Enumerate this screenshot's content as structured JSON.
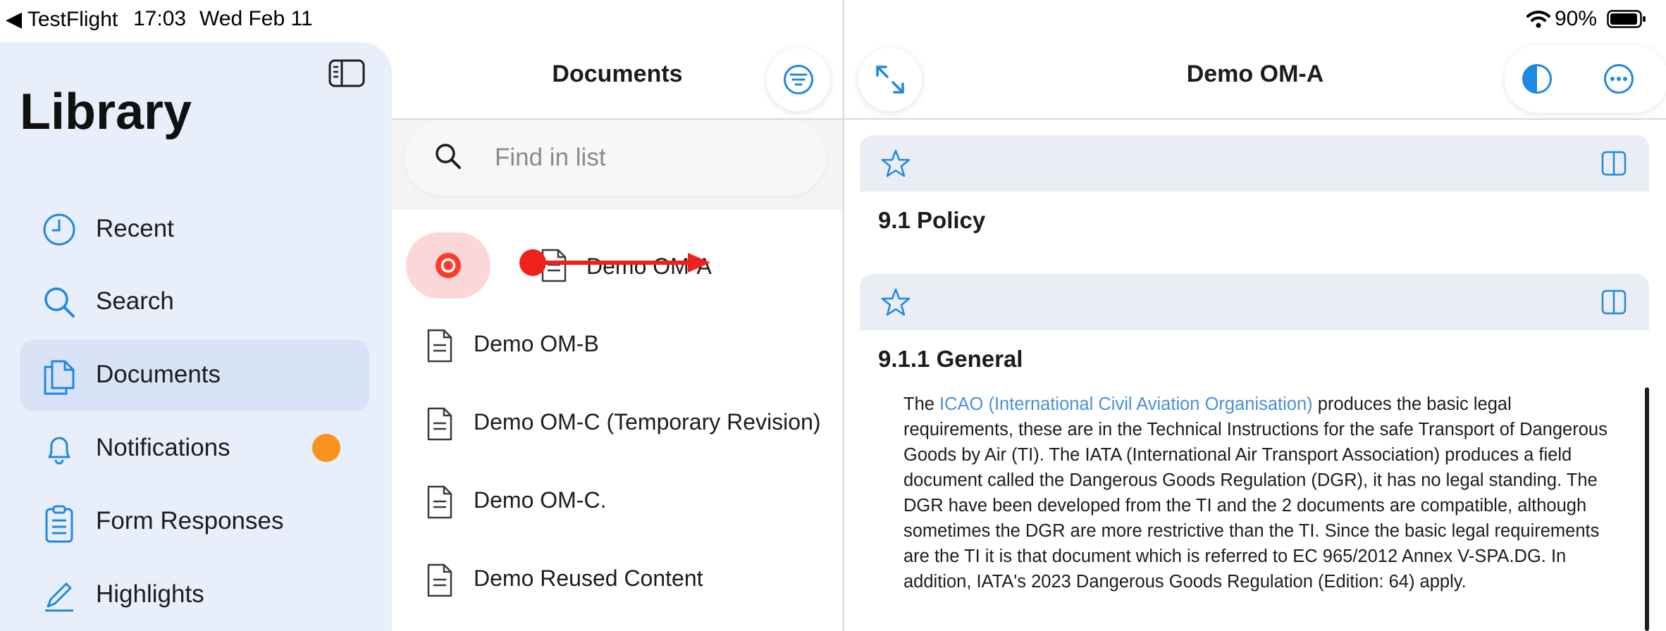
{
  "status_bar": {
    "back_app": "◀ TestFlight",
    "time": "17:03",
    "date": "Wed Feb 11",
    "battery_percent": "90%",
    "icons": [
      "wifi-icon",
      "battery-icon"
    ]
  },
  "sidebar": {
    "title": "Library",
    "items": [
      {
        "label": "Recent",
        "icon": "clock-icon"
      },
      {
        "label": "Search",
        "icon": "magnifier-icon"
      },
      {
        "label": "Documents",
        "icon": "documents-icon",
        "active": true
      },
      {
        "label": "Notifications",
        "icon": "bell-icon",
        "badge_color": "#f7931e"
      },
      {
        "label": "Form Responses",
        "icon": "clipboard-icon"
      },
      {
        "label": "Highlights",
        "icon": "pencil-icon"
      }
    ]
  },
  "list": {
    "title": "Documents",
    "search_placeholder": "Find in list",
    "items": [
      {
        "label": "Demo OM-A",
        "swiped": true
      },
      {
        "label": "Demo OM-B"
      },
      {
        "label": "Demo OM-C (Temporary Revision)"
      },
      {
        "label": "Demo OM-C."
      },
      {
        "label": "Demo Reused Content"
      }
    ]
  },
  "detail": {
    "title": "Demo OM-A",
    "sections": [
      {
        "heading": "9.1 Policy"
      },
      {
        "heading": "9.1.1 General"
      }
    ],
    "paragraph": {
      "prefix": "The ",
      "link": "ICAO (International Civil Aviation Organisation)",
      "body": " produces the basic legal requirements, these are in the Technical Instructions for the safe Transport of Dangerous Goods by Air (TI). The IATA (International Air Transport Association) produces a field document called the Dangerous Goods Regulation (DGR), it has no legal standing. The DGR have been developed from the TI and the 2 documents are compatible, although sometimes the DGR are more restrictive than the TI. Since the basic legal requirements are the TI it is that document which is referred to EC 965/2012 Annex V-SPA.DG. In addition, IATA's 2023 Dangerous Goods Regulation (Edition: 64) apply."
    }
  },
  "colors": {
    "accent": "#1e88e5",
    "sidebar_bg": "#e9effa",
    "sidebar_active": "#d8e3f6",
    "delete_red": "#ff3b30",
    "swipe_arrow": "#f0201c",
    "badge": "#f7931e"
  }
}
